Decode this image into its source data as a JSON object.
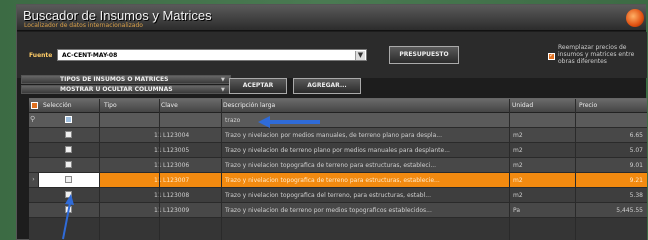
{
  "window": {
    "title": "Buscador de Insumos y Matrices",
    "subtitle": "Localizador de datos internacionalizado"
  },
  "toolbar": {
    "fuente_label": "Fuente",
    "fuente_value": "AC-CENT-MAY-08",
    "presupuesto_label": "PRESUPUESTO",
    "replace_text": "Reemplazar precios de insumos y matrices entre obras diferentes"
  },
  "options": {
    "tipos_label": "TIPOS DE INSUMOS O MATRICES",
    "mostrar_label": "MOSTRAR U OCULTAR COLUMNAS",
    "aceptar_label": "ACEPTAR",
    "agregar_label": "AGREGAR..."
  },
  "grid": {
    "columns": [
      "Selección",
      "Tipo",
      "Clave",
      "Descripción larga",
      "Unidad",
      "Precio"
    ],
    "filter_text": "trazo",
    "rows": [
      {
        "tipo": "11",
        "clave": "L123004",
        "descripcion": "Trazo y nivelacion por medios manuales, de terreno plano para despla...",
        "unidad": "m2",
        "precio": "6.65",
        "selected": false
      },
      {
        "tipo": "11",
        "clave": "L123005",
        "descripcion": "Trazo y nivelacion de terreno plano por medios manuales para desplante...",
        "unidad": "m2",
        "precio": "5.07",
        "selected": false
      },
      {
        "tipo": "11",
        "clave": "L123006",
        "descripcion": "Trazo y nivelacion topografica de terreno para estructuras, estableci...",
        "unidad": "m2",
        "precio": "9.01",
        "selected": false
      },
      {
        "tipo": "11",
        "clave": "L123007",
        "descripcion": "Trazo y nivelacion topografica de terreno para estructuras, establecie...",
        "unidad": "m2",
        "precio": "9.21",
        "selected": true
      },
      {
        "tipo": "11",
        "clave": "L123008",
        "descripcion": "Trazo y nivelacion topografica del terreno, para estructuras, establ...",
        "unidad": "m2",
        "precio": "5.38",
        "selected": false
      },
      {
        "tipo": "11",
        "clave": "L123009",
        "descripcion": "Trazo y nivelacion de terreno por medios topograficos establecidos...",
        "unidad": "Pa",
        "precio": "5,445.55",
        "selected": false
      }
    ]
  },
  "colors": {
    "accent": "#f28a10",
    "annotation_arrow": "#2f6bd8"
  }
}
